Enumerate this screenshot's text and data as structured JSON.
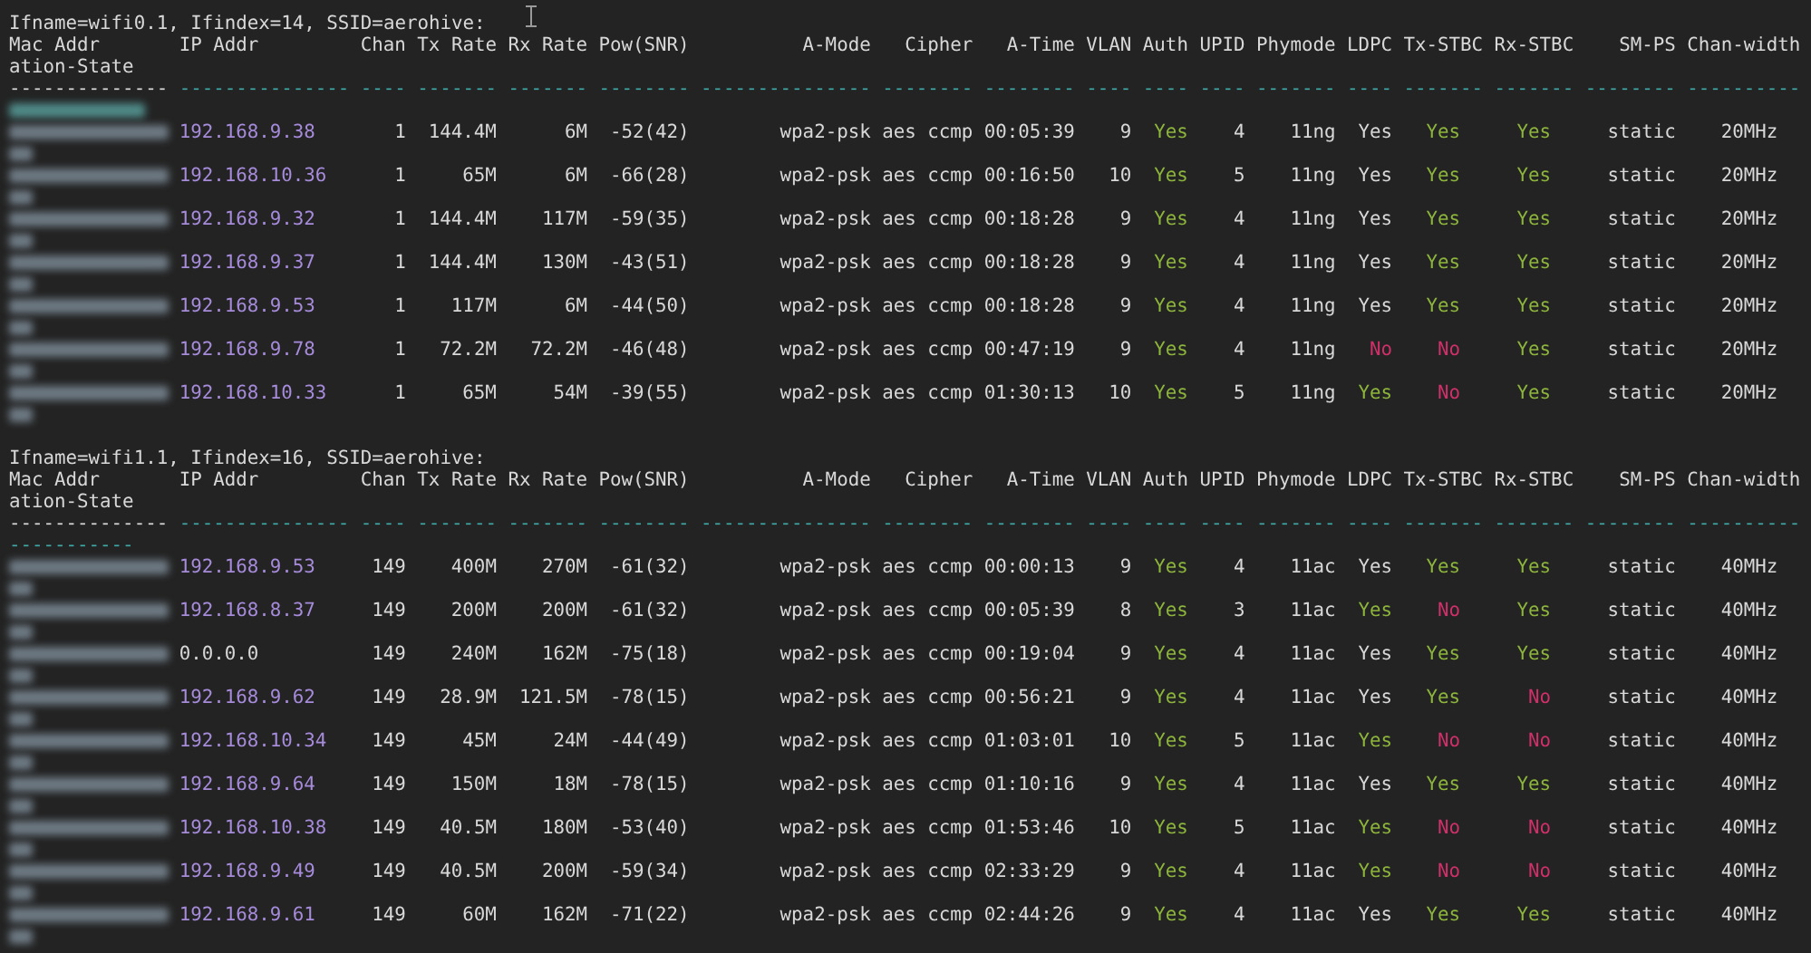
{
  "sections": [
    {
      "title": "Ifname=wifi0.1, Ifindex=14, SSID=aerohive:",
      "columns": [
        "Mac Addr",
        "IP Addr",
        "Chan",
        "Tx Rate",
        "Rx Rate",
        "Pow(SNR)",
        "A-Mode",
        "Cipher",
        "A-Time",
        "VLAN",
        "Auth",
        "UPID",
        "Phymode",
        "LDPC",
        "Tx-STBC",
        "Rx-STBC",
        "SM-PS",
        "Chan-width"
      ],
      "header_wrap": "ation-State",
      "separator": [
        {
          "text": "--------------",
          "color": "#d8d8d8"
        },
        {
          "text": "---------------",
          "color": "#3fa9a5"
        },
        {
          "text": "----",
          "color": "#3fa9a5"
        },
        {
          "text": "-------",
          "color": "#3fa9a5"
        },
        {
          "text": "-------",
          "color": "#3fa9a5"
        },
        {
          "text": "--------",
          "color": "#3fa9a5"
        },
        {
          "text": "---------------",
          "color": "#3fa9a5"
        },
        {
          "text": "--------",
          "color": "#3fa9a5"
        },
        {
          "text": "--------",
          "color": "#3fa9a5"
        },
        {
          "text": "----",
          "color": "#3fa9a5"
        },
        {
          "text": "----",
          "color": "#3fa9a5"
        },
        {
          "text": "----",
          "color": "#3fa9a5"
        },
        {
          "text": "-------",
          "color": "#3fa9a5"
        },
        {
          "text": "----",
          "color": "#3fa9a5"
        },
        {
          "text": "-------",
          "color": "#3fa9a5"
        },
        {
          "text": "-------",
          "color": "#3fa9a5"
        },
        {
          "text": "--------",
          "color": "#3fa9a5"
        },
        {
          "text": "----------",
          "color": "#3fa9a5"
        }
      ],
      "rows": [
        {
          "cells": [
            "",
            {
              "text": "192.168.9.38",
              "color": "#a68bdb"
            },
            "1",
            "144.4M",
            "6M",
            "-52(42)",
            "wpa2-psk",
            "aes ccmp",
            "00:05:39",
            "9",
            {
              "text": "Yes",
              "color": "#8db53c"
            },
            "4",
            "11ng",
            "Yes",
            {
              "text": "Yes",
              "color": "#8db53c"
            },
            {
              "text": "Yes",
              "color": "#8db53c"
            },
            "static",
            "20MHz"
          ]
        },
        {
          "cells": [
            "",
            {
              "text": "192.168.10.36",
              "color": "#a68bdb"
            },
            "1",
            "65M",
            "6M",
            "-66(28)",
            "wpa2-psk",
            "aes ccmp",
            "00:16:50",
            "10",
            {
              "text": "Yes",
              "color": "#8db53c"
            },
            "5",
            "11ng",
            "Yes",
            {
              "text": "Yes",
              "color": "#8db53c"
            },
            {
              "text": "Yes",
              "color": "#8db53c"
            },
            "static",
            "20MHz"
          ]
        },
        {
          "cells": [
            "",
            {
              "text": "192.168.9.32",
              "color": "#a68bdb"
            },
            "1",
            "144.4M",
            "117M",
            "-59(35)",
            "wpa2-psk",
            "aes ccmp",
            "00:18:28",
            "9",
            {
              "text": "Yes",
              "color": "#8db53c"
            },
            "4",
            "11ng",
            "Yes",
            {
              "text": "Yes",
              "color": "#8db53c"
            },
            {
              "text": "Yes",
              "color": "#8db53c"
            },
            "static",
            "20MHz"
          ]
        },
        {
          "cells": [
            "",
            {
              "text": "192.168.9.37",
              "color": "#a68bdb"
            },
            "1",
            "144.4M",
            "130M",
            "-43(51)",
            "wpa2-psk",
            "aes ccmp",
            "00:18:28",
            "9",
            {
              "text": "Yes",
              "color": "#8db53c"
            },
            "4",
            "11ng",
            "Yes",
            {
              "text": "Yes",
              "color": "#8db53c"
            },
            {
              "text": "Yes",
              "color": "#8db53c"
            },
            "static",
            "20MHz"
          ]
        },
        {
          "cells": [
            "",
            {
              "text": "192.168.9.53",
              "color": "#a68bdb"
            },
            "1",
            "117M",
            "6M",
            "-44(50)",
            "wpa2-psk",
            "aes ccmp",
            "00:18:28",
            "9",
            {
              "text": "Yes",
              "color": "#8db53c"
            },
            "4",
            "11ng",
            "Yes",
            {
              "text": "Yes",
              "color": "#8db53c"
            },
            {
              "text": "Yes",
              "color": "#8db53c"
            },
            "static",
            "20MHz"
          ]
        },
        {
          "cells": [
            "",
            {
              "text": "192.168.9.78",
              "color": "#a68bdb"
            },
            "1",
            "72.2M",
            "72.2M",
            "-46(48)",
            "wpa2-psk",
            "aes ccmp",
            "00:47:19",
            "9",
            {
              "text": "Yes",
              "color": "#8db53c"
            },
            "4",
            "11ng",
            {
              "text": "No",
              "color": "#d0306a"
            },
            {
              "text": "No",
              "color": "#d0306a"
            },
            {
              "text": "Yes",
              "color": "#8db53c"
            },
            "static",
            "20MHz"
          ]
        },
        {
          "cells": [
            "",
            {
              "text": "192.168.10.33",
              "color": "#a68bdb"
            },
            "1",
            "65M",
            "54M",
            "-39(55)",
            "wpa2-psk",
            "aes ccmp",
            "01:30:13",
            "10",
            {
              "text": "Yes",
              "color": "#8db53c"
            },
            "5",
            "11ng",
            {
              "text": "Yes",
              "color": "#8db53c"
            },
            {
              "text": "No",
              "color": "#d0306a"
            },
            {
              "text": "Yes",
              "color": "#8db53c"
            },
            "static",
            "20MHz"
          ]
        }
      ]
    },
    {
      "title": "Ifname=wifi1.1, Ifindex=16, SSID=aerohive:",
      "columns": [
        "Mac Addr",
        "IP Addr",
        "Chan",
        "Tx Rate",
        "Rx Rate",
        "Pow(SNR)",
        "A-Mode",
        "Cipher",
        "A-Time",
        "VLAN",
        "Auth",
        "UPID",
        "Phymode",
        "LDPC",
        "Tx-STBC",
        "Rx-STBC",
        "SM-PS",
        "Chan-width"
      ],
      "header_wrap": "ation-State",
      "separator": [
        {
          "text": "--------------",
          "color": "#d8d8d8"
        },
        {
          "text": "---------------",
          "color": "#3fa9a5"
        },
        {
          "text": "----",
          "color": "#3fa9a5"
        },
        {
          "text": "-------",
          "color": "#3fa9a5"
        },
        {
          "text": "-------",
          "color": "#3fa9a5"
        },
        {
          "text": "--------",
          "color": "#3fa9a5"
        },
        {
          "text": "---------------",
          "color": "#3fa9a5"
        },
        {
          "text": "--------",
          "color": "#3fa9a5"
        },
        {
          "text": "--------",
          "color": "#3fa9a5"
        },
        {
          "text": "----",
          "color": "#3fa9a5"
        },
        {
          "text": "----",
          "color": "#3fa9a5"
        },
        {
          "text": "----",
          "color": "#3fa9a5"
        },
        {
          "text": "-------",
          "color": "#3fa9a5"
        },
        {
          "text": "----",
          "color": "#3fa9a5"
        },
        {
          "text": "-------",
          "color": "#3fa9a5"
        },
        {
          "text": "-------",
          "color": "#3fa9a5"
        },
        {
          "text": "--------",
          "color": "#3fa9a5"
        },
        {
          "text": "----------",
          "color": "#3fa9a5"
        }
      ],
      "separator_wrap": {
        "text": "-----------",
        "color": "#3fa9a5"
      },
      "rows": [
        {
          "cells": [
            "",
            {
              "text": "192.168.9.53",
              "color": "#a68bdb"
            },
            "149",
            "400M",
            "270M",
            "-61(32)",
            "wpa2-psk",
            "aes ccmp",
            "00:00:13",
            "9",
            {
              "text": "Yes",
              "color": "#8db53c"
            },
            "4",
            "11ac",
            "Yes",
            {
              "text": "Yes",
              "color": "#8db53c"
            },
            {
              "text": "Yes",
              "color": "#8db53c"
            },
            "static",
            "40MHz"
          ]
        },
        {
          "cells": [
            "",
            {
              "text": "192.168.8.37",
              "color": "#a68bdb"
            },
            "149",
            "200M",
            "200M",
            "-61(32)",
            "wpa2-psk",
            "aes ccmp",
            "00:05:39",
            "8",
            {
              "text": "Yes",
              "color": "#8db53c"
            },
            "3",
            "11ac",
            {
              "text": "Yes",
              "color": "#8db53c"
            },
            {
              "text": "No",
              "color": "#d0306a"
            },
            {
              "text": "Yes",
              "color": "#8db53c"
            },
            "static",
            "40MHz"
          ]
        },
        {
          "cells": [
            "",
            "0.0.0.0",
            "149",
            "240M",
            "162M",
            "-75(18)",
            "wpa2-psk",
            "aes ccmp",
            "00:19:04",
            "9",
            {
              "text": "Yes",
              "color": "#8db53c"
            },
            "4",
            "11ac",
            "Yes",
            {
              "text": "Yes",
              "color": "#8db53c"
            },
            {
              "text": "Yes",
              "color": "#8db53c"
            },
            "static",
            "40MHz"
          ]
        },
        {
          "cells": [
            "",
            {
              "text": "192.168.9.62",
              "color": "#a68bdb"
            },
            "149",
            "28.9M",
            "121.5M",
            "-78(15)",
            "wpa2-psk",
            "aes ccmp",
            "00:56:21",
            "9",
            {
              "text": "Yes",
              "color": "#8db53c"
            },
            "4",
            "11ac",
            "Yes",
            {
              "text": "Yes",
              "color": "#8db53c"
            },
            {
              "text": "No",
              "color": "#d0306a"
            },
            "static",
            "40MHz"
          ]
        },
        {
          "cells": [
            "",
            {
              "text": "192.168.10.34",
              "color": "#a68bdb"
            },
            "149",
            "45M",
            "24M",
            "-44(49)",
            "wpa2-psk",
            "aes ccmp",
            "01:03:01",
            "10",
            {
              "text": "Yes",
              "color": "#8db53c"
            },
            "5",
            "11ac",
            {
              "text": "Yes",
              "color": "#8db53c"
            },
            {
              "text": "No",
              "color": "#d0306a"
            },
            {
              "text": "No",
              "color": "#d0306a"
            },
            "static",
            "40MHz"
          ]
        },
        {
          "cells": [
            "",
            {
              "text": "192.168.9.64",
              "color": "#a68bdb"
            },
            "149",
            "150M",
            "18M",
            "-78(15)",
            "wpa2-psk",
            "aes ccmp",
            "01:10:16",
            "9",
            {
              "text": "Yes",
              "color": "#8db53c"
            },
            "4",
            "11ac",
            "Yes",
            {
              "text": "Yes",
              "color": "#8db53c"
            },
            {
              "text": "Yes",
              "color": "#8db53c"
            },
            "static",
            "40MHz"
          ]
        },
        {
          "cells": [
            "",
            {
              "text": "192.168.10.38",
              "color": "#a68bdb"
            },
            "149",
            "40.5M",
            "180M",
            "-53(40)",
            "wpa2-psk",
            "aes ccmp",
            "01:53:46",
            "10",
            {
              "text": "Yes",
              "color": "#8db53c"
            },
            "5",
            "11ac",
            {
              "text": "Yes",
              "color": "#8db53c"
            },
            {
              "text": "No",
              "color": "#d0306a"
            },
            {
              "text": "No",
              "color": "#d0306a"
            },
            "static",
            "40MHz"
          ]
        },
        {
          "cells": [
            "",
            {
              "text": "192.168.9.49",
              "color": "#a68bdb"
            },
            "149",
            "40.5M",
            "200M",
            "-59(34)",
            "wpa2-psk",
            "aes ccmp",
            "02:33:29",
            "9",
            {
              "text": "Yes",
              "color": "#8db53c"
            },
            "4",
            "11ac",
            {
              "text": "Yes",
              "color": "#8db53c"
            },
            {
              "text": "No",
              "color": "#d0306a"
            },
            {
              "text": "No",
              "color": "#d0306a"
            },
            "static",
            "40MHz"
          ]
        },
        {
          "cells": [
            "",
            {
              "text": "192.168.9.61",
              "color": "#a68bdb"
            },
            "149",
            "60M",
            "162M",
            "-71(22)",
            "wpa2-psk",
            "aes ccmp",
            "02:44:26",
            "9",
            {
              "text": "Yes",
              "color": "#8db53c"
            },
            "4",
            "11ac",
            "Yes",
            {
              "text": "Yes",
              "color": "#8db53c"
            },
            {
              "text": "Yes",
              "color": "#8db53c"
            },
            "static",
            "40MHz"
          ]
        }
      ]
    }
  ]
}
